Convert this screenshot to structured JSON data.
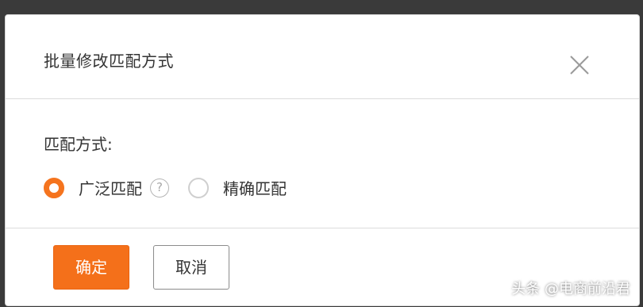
{
  "dialog": {
    "title": "批量修改匹配方式",
    "close_icon": "close-icon",
    "field_label": "匹配方式:",
    "options": [
      {
        "label": "广泛匹配",
        "checked": true,
        "help_icon": "question-circle-icon",
        "help_glyph": "?"
      },
      {
        "label": "精确匹配",
        "checked": false
      }
    ],
    "confirm_label": "确定",
    "cancel_label": "取消",
    "accent_color": "#f4701a"
  },
  "watermark": "头条 @电商前沿君"
}
